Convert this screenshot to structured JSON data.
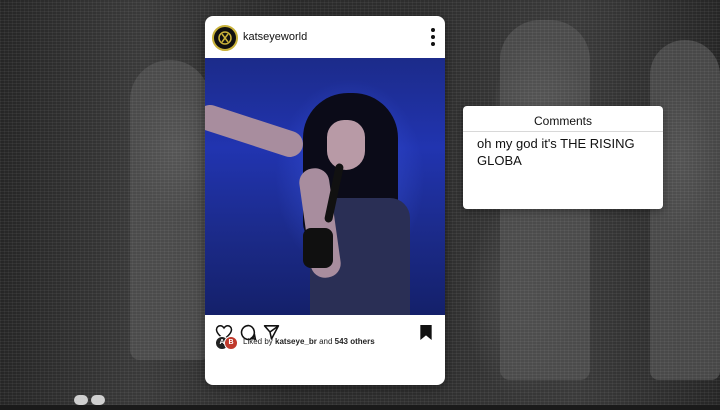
{
  "post": {
    "username": "katseyeworld",
    "likes_text_prefix": "Liked by ",
    "likes_user": "katseye_br",
    "likes_text_mid": " and ",
    "likes_others": "543 others",
    "liker_avatar_letters": [
      "A",
      "B"
    ]
  },
  "comments": {
    "title": "Comments",
    "text": "oh my god it's THE RISING GLOBA"
  },
  "icons": {
    "avatar": "katseye-logo-icon",
    "more": "more-vertical-icon",
    "like": "heart-icon",
    "comment": "comment-bubble-icon",
    "share": "send-icon",
    "save": "bookmark-icon"
  }
}
